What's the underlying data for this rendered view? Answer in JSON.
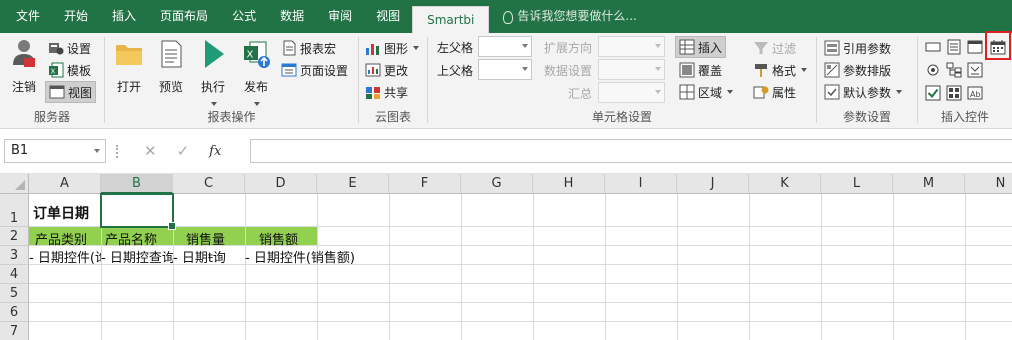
{
  "menu": {
    "tabs": [
      "文件",
      "开始",
      "插入",
      "页面布局",
      "公式",
      "数据",
      "审阅",
      "视图",
      "Smartbi"
    ],
    "active_tab": "Smartbi",
    "tell_me": "告诉我您想要做什么..."
  },
  "ribbon": {
    "server": {
      "login": "注销",
      "settings": "设置",
      "template": "模板",
      "view": "视图",
      "group_label": "服务器"
    },
    "report_ops": {
      "open": "打开",
      "preview": "预览",
      "execute": "执行",
      "publish": "发布",
      "report_macro": "报表宏",
      "page_setup": "页面设置",
      "group_label": "报表操作"
    },
    "cloud_chart": {
      "chart": "图形",
      "update": "更改",
      "share": "共享",
      "group_label": "云图表"
    },
    "cell_settings": {
      "left_parent": "左父格",
      "up_parent": "上父格",
      "expand_dir": "扩展方向",
      "data_setting": "数据设置",
      "summary": "汇总",
      "insert": "插入",
      "overwrite": "覆盖",
      "region": "区域",
      "filter": "过滤",
      "format": "格式",
      "property": "属性",
      "group_label": "单元格设置"
    },
    "param_settings": {
      "ref_param": "引用参数",
      "param_layout": "参数排版",
      "default_param": "默认参数",
      "group_label": "参数设置"
    },
    "insert_controls": {
      "group_label": "插入控件"
    }
  },
  "formula_bar": {
    "name_box": "B1",
    "cancel": "✕",
    "confirm": "✓",
    "fx": "fx",
    "formula": ""
  },
  "sheet": {
    "columns": [
      "A",
      "B",
      "C",
      "D",
      "E",
      "F",
      "G",
      "H",
      "I",
      "J",
      "K",
      "L",
      "M",
      "N"
    ],
    "rows": [
      "1",
      "2",
      "3",
      "4",
      "5",
      "6",
      "7"
    ],
    "selected_cell": "B1",
    "cells": {
      "A1": "订单日期",
      "A2": "产品类别",
      "B2": "产品名称",
      "C2": "销售量",
      "D2": "销售额",
      "A3": "- 日期控件(询",
      "B3": "- 日期控查询",
      "C3": "- 日期ŧ询",
      "D3": "- 日期控件(销售额)"
    },
    "header_fill": "#92d050"
  },
  "colors": {
    "excel_green": "#217346",
    "ribbon_bg": "#f3f3f3",
    "highlight_red": "#e02020"
  }
}
